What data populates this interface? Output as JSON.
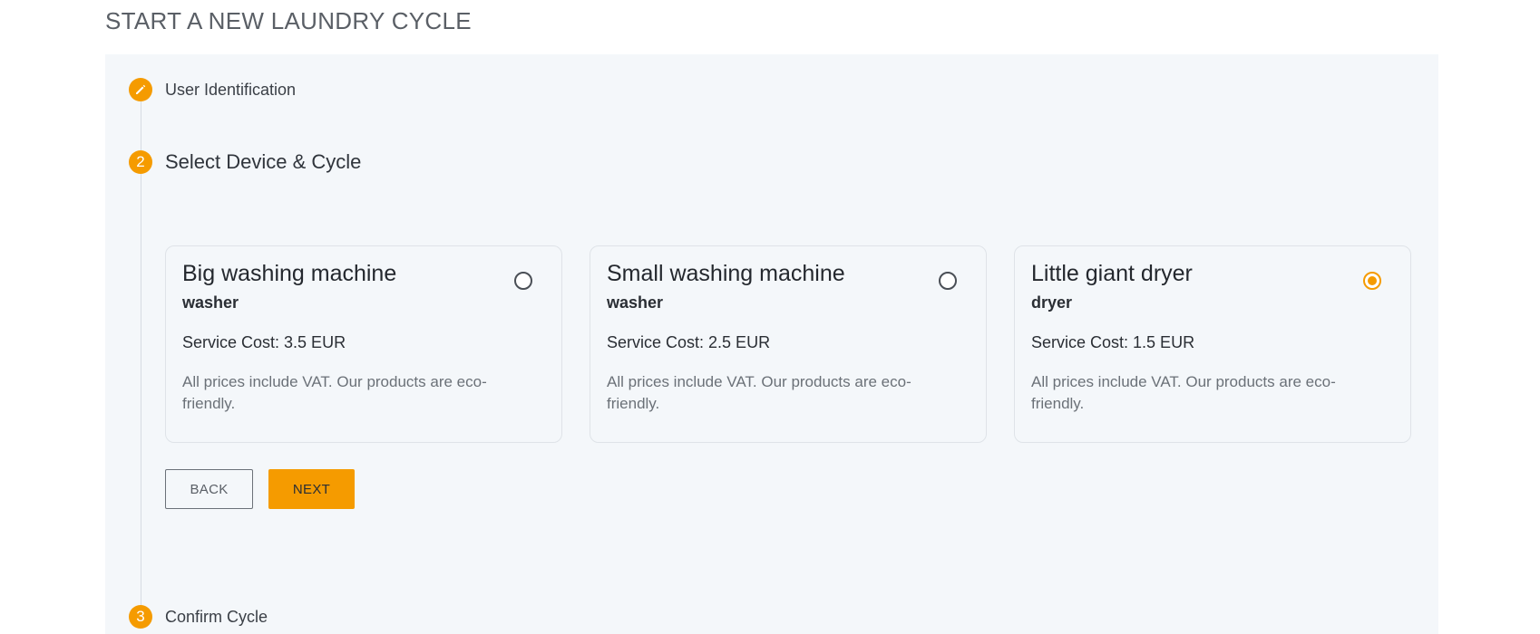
{
  "page": {
    "title": "START A NEW LAUNDRY CYCLE"
  },
  "colors": {
    "accent": "#f59b00",
    "panel_bg": "#f4f7fa"
  },
  "steps": [
    {
      "icon": "pencil-icon",
      "badge": "",
      "label": "User Identification"
    },
    {
      "icon": "",
      "badge": "2",
      "label": "Select Device & Cycle"
    },
    {
      "icon": "",
      "badge": "3",
      "label": "Confirm Cycle"
    }
  ],
  "devices": [
    {
      "name": "Big washing machine",
      "type": "washer",
      "cost": "Service Cost: 3.5 EUR",
      "note": "All prices include VAT. Our products are eco-friendly.",
      "selected": false
    },
    {
      "name": "Small washing machine",
      "type": "washer",
      "cost": "Service Cost: 2.5 EUR",
      "note": "All prices include VAT. Our products are eco-friendly.",
      "selected": false
    },
    {
      "name": "Little giant dryer",
      "type": "dryer",
      "cost": "Service Cost: 1.5 EUR",
      "note": "All prices include VAT. Our products are eco-friendly.",
      "selected": true
    }
  ],
  "actions": {
    "back_label": "BACK",
    "next_label": "NEXT"
  }
}
